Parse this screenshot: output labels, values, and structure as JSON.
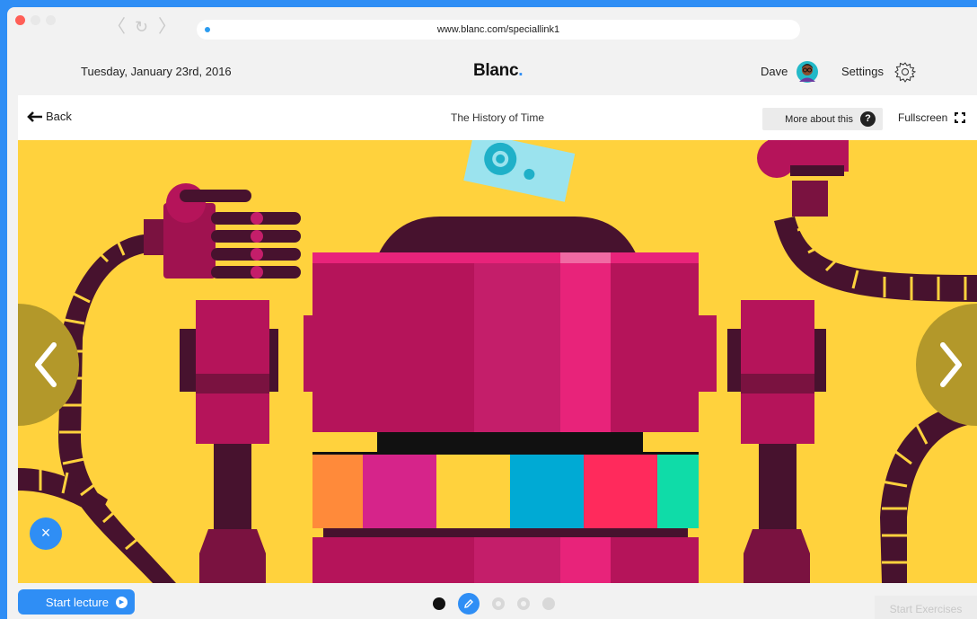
{
  "browser": {
    "url": "www.blanc.com/speciallink1",
    "back_arrow": "〈",
    "reload_icon": "↻",
    "forward_arrow": "〉"
  },
  "header": {
    "date": "Tuesday, January 23rd, 2016",
    "brand": "Blanc",
    "brand_dot": ".",
    "user_name": "Dave",
    "settings_label": "Settings"
  },
  "toolbar": {
    "back_label": "Back",
    "title": "The History of Time",
    "more_label": "More about this",
    "help_glyph": "?",
    "fullscreen_label": "Fullscreen"
  },
  "stage": {
    "prev_glyph": "‹",
    "next_glyph": "›",
    "close_glyph": "×"
  },
  "footer": {
    "start_lecture_label": "Start lecture",
    "start_exercises_label": "Start Exercises",
    "pages": [
      "current",
      "edit",
      "inactive",
      "inactive",
      "inactive"
    ]
  },
  "colors": {
    "accent": "#2f8ef5",
    "stage_bg": "#ffd23d",
    "robot_magenta": "#b5145a",
    "robot_pink": "#e8237a",
    "robot_dark": "#47122e"
  },
  "icons": [
    "close-traffic-icon",
    "back-arrow-icon",
    "reload-icon",
    "forward-arrow-icon",
    "avatar-icon",
    "gear-icon",
    "back-arrow-left-icon",
    "help-icon",
    "fullscreen-icon",
    "prev-arrow-icon",
    "next-arrow-icon",
    "close-icon",
    "play-icon",
    "pencil-icon"
  ]
}
